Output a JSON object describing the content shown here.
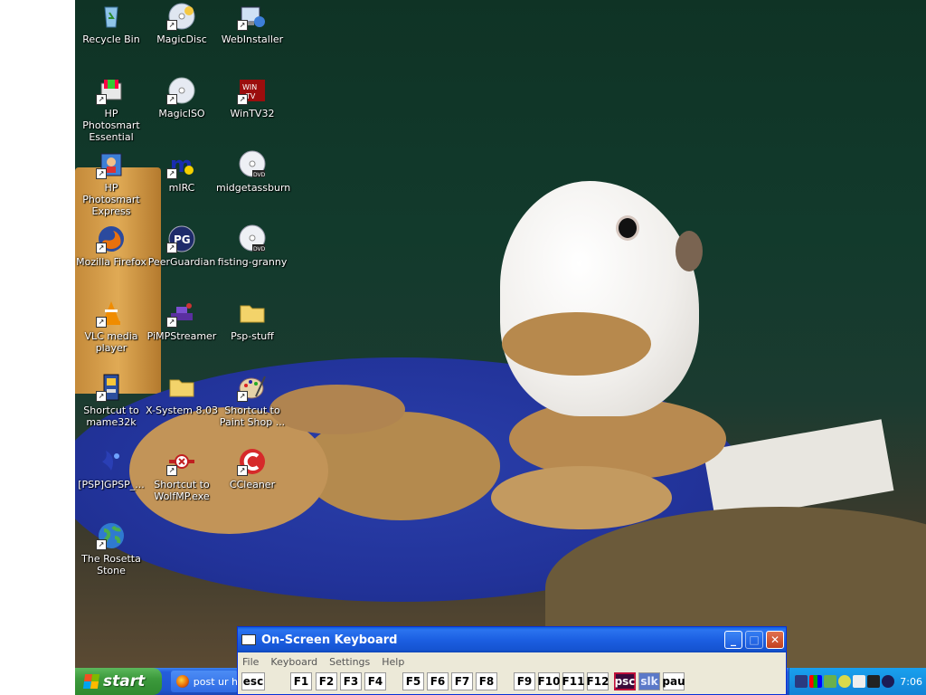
{
  "desktop": {
    "icons": [
      {
        "label": "Recycle Bin",
        "icon": "recycle-bin-icon",
        "shortcut": false
      },
      {
        "label": "MagicDisc",
        "icon": "magicdisc-icon",
        "shortcut": true
      },
      {
        "label": "WebInstaller",
        "icon": "webinstaller-icon",
        "shortcut": true
      },
      {
        "label": "HP Photosmart\nEssential",
        "icon": "hp-photosmart-icon",
        "shortcut": true
      },
      {
        "label": "MagicISO",
        "icon": "magiciso-icon",
        "shortcut": true
      },
      {
        "label": "WinTV32",
        "icon": "wintv-icon",
        "shortcut": true
      },
      {
        "label": "HP Photosmart\nExpress",
        "icon": "hp-photosmart-express-icon",
        "shortcut": true
      },
      {
        "label": "mIRC",
        "icon": "mirc-icon",
        "shortcut": true
      },
      {
        "label": "midgetassburn",
        "icon": "dvd-icon",
        "shortcut": false
      },
      {
        "label": "Mozilla Firefox",
        "icon": "firefox-icon",
        "shortcut": true
      },
      {
        "label": "PeerGuardian",
        "icon": "peerguardian-icon",
        "shortcut": true
      },
      {
        "label": "fisting-granny",
        "icon": "dvd-icon",
        "shortcut": false
      },
      {
        "label": "VLC media\nplayer",
        "icon": "vlc-icon",
        "shortcut": true
      },
      {
        "label": "PiMPStreamer",
        "icon": "pimpstreamer-icon",
        "shortcut": true
      },
      {
        "label": "Psp-stuff",
        "icon": "folder-icon",
        "shortcut": false
      },
      {
        "label": "Shortcut to\nmame32k",
        "icon": "mame-icon",
        "shortcut": true
      },
      {
        "label": "X-System 8.03",
        "icon": "folder-icon",
        "shortcut": false
      },
      {
        "label": "Shortcut to\nPaint Shop ...",
        "icon": "paint-shop-icon",
        "shortcut": true
      },
      {
        "label": "[PSP]GPSP_...",
        "icon": "gpsp-icon",
        "shortcut": false
      },
      {
        "label": "Shortcut to\nWolfMP.exe",
        "icon": "wolfmp-icon",
        "shortcut": true
      },
      {
        "label": "CCleaner",
        "icon": "ccleaner-icon",
        "shortcut": true
      },
      {
        "label": "The Rosetta\nStone",
        "icon": "globe-icon",
        "shortcut": true
      }
    ]
  },
  "taskbar": {
    "start_label": "start",
    "task_button": "post ur h",
    "clock": "7:06"
  },
  "osk": {
    "title": "On-Screen Keyboard",
    "menu": [
      "File",
      "Keyboard",
      "Settings",
      "Help"
    ],
    "keys": [
      "esc",
      "F1",
      "F2",
      "F3",
      "F4",
      "F5",
      "F6",
      "F7",
      "F8",
      "F9",
      "F10",
      "F11",
      "F12",
      "psc",
      "slk",
      "pau"
    ]
  },
  "colors": {
    "taskbar": "#245edb",
    "start": "#3c9a3c",
    "tray": "#1283d6",
    "osk_title": "#1c5fe2",
    "osk_body": "#ece9d8"
  }
}
